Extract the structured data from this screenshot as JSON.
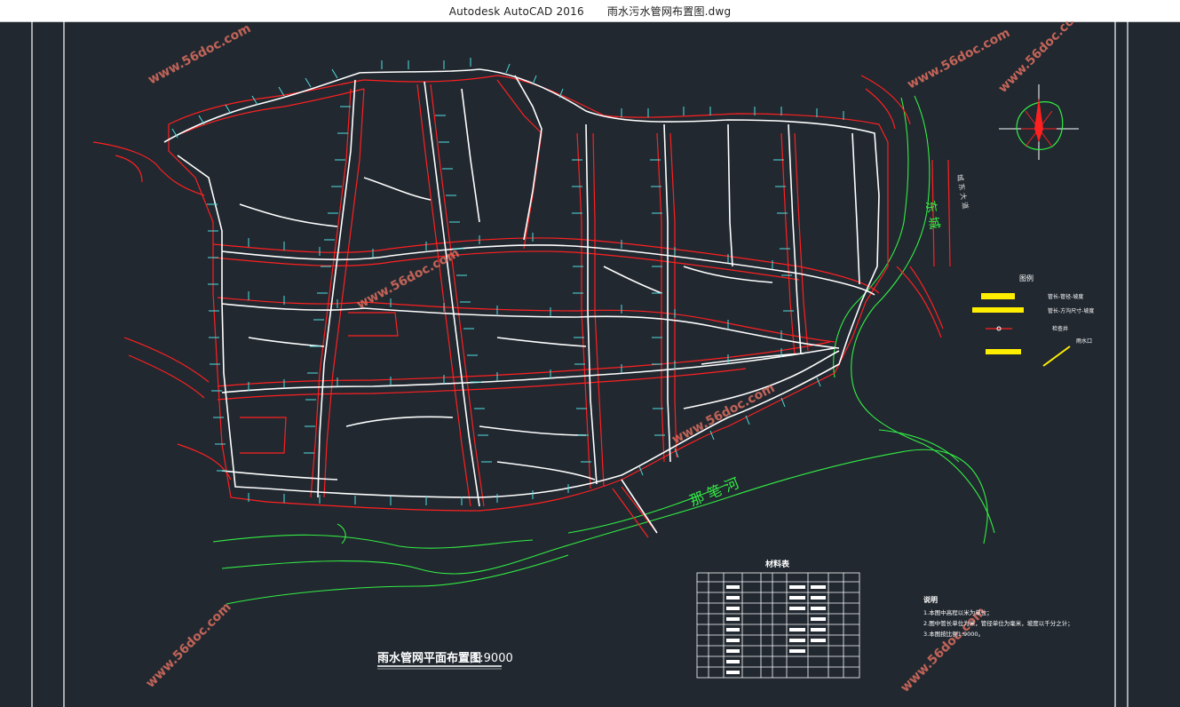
{
  "window": {
    "app": "Autodesk AutoCAD 2016",
    "file": "雨水污水管网布置图.dwg"
  },
  "drawing": {
    "main_title": "雨水管网平面布置图",
    "scale": "1:9000",
    "river_label": "那 笔 河",
    "east_river_label": "东 城",
    "east_road_label": "城 东 大 道",
    "materials_title": "材料表",
    "notes_title": "说明",
    "notes": [
      "1.本图中高程以米为单位；",
      "2.图中管长单位为米，管径单位为毫米，坡度以千分之计；",
      "3.本图按比例1:9000。"
    ],
    "legend_title": "图例",
    "legend_items": [
      "管长-管径-坡度",
      "管长-方沟尺寸-坡度",
      "检查井",
      "雨水口"
    ],
    "watermark": "www.56doc.com"
  },
  "colors": {
    "background": "#212830",
    "pipe": "#ffffff",
    "pipe_label": "#4fe0e0",
    "road": "#ff2020",
    "river": "#33ee44",
    "legend_yellow": "#ffee00",
    "watermark": "#e07060"
  }
}
